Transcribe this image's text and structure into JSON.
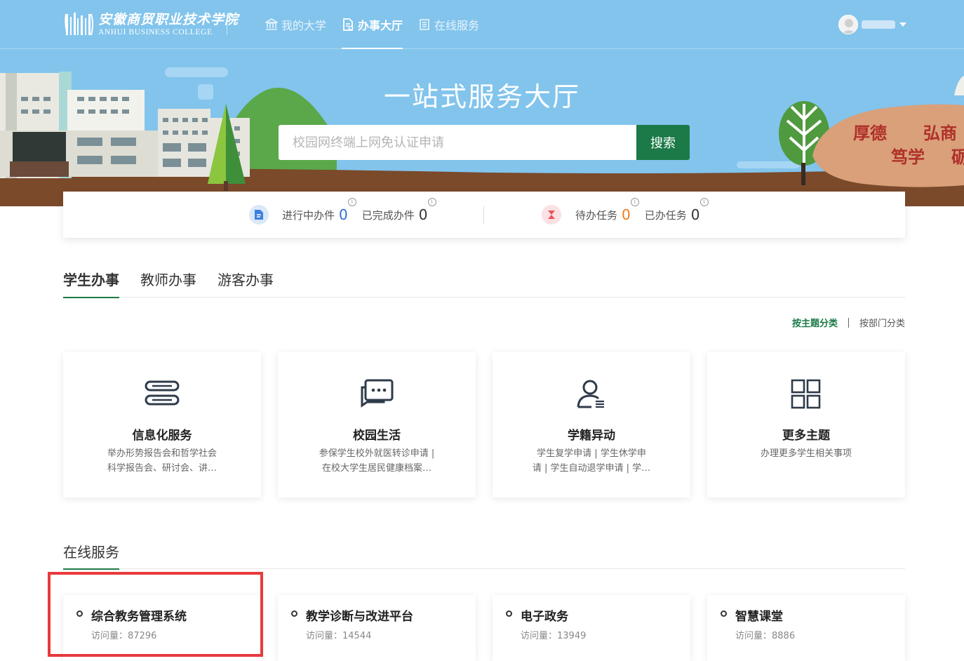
{
  "header": {
    "logo_cn": "安徽商贸职业技术学院",
    "logo_en": "ANHUI BUSINESS COLLEGE",
    "nav": [
      {
        "label": "我的大学",
        "icon": "building-icon",
        "active": false
      },
      {
        "label": "办事大厅",
        "icon": "document-icon",
        "active": true
      },
      {
        "label": "在线服务",
        "icon": "list-icon",
        "active": false
      }
    ]
  },
  "hero": {
    "title": "一站式服务大厅",
    "search_placeholder": "校园网终端上网免认证申请",
    "search_button": "搜索",
    "rock_text": [
      "厚德",
      "弘商",
      "笃学",
      "砺"
    ]
  },
  "stats": {
    "in_progress_label": "进行中办件",
    "in_progress_value": "0",
    "completed_label": "已完成办件",
    "completed_value": "0",
    "todo_label": "待办任务",
    "todo_value": "0",
    "done_label": "已办任务",
    "done_value": "0",
    "info_glyph": "i"
  },
  "tabs": [
    "学生办事",
    "教师办事",
    "游客办事"
  ],
  "sort": {
    "by_topic": "按主题分类",
    "by_department": "按部门分类"
  },
  "cards": [
    {
      "title": "信息化服务",
      "icon": "server-icon",
      "desc": [
        "举办形势报告会和哲学社会",
        "科学报告会、研讨会、讲…"
      ]
    },
    {
      "title": "校园生活",
      "icon": "chat-icon",
      "desc": [
        "参保学生校外就医转诊申请 |",
        "在校大学生居民健康档案…"
      ]
    },
    {
      "title": "学籍异动",
      "icon": "user-list-icon",
      "desc": [
        "学生复学申请 | 学生休学申",
        "请 | 学生自动退学申请 | 学…"
      ]
    },
    {
      "title": "更多主题",
      "icon": "grid-icon",
      "desc": [
        "办理更多学生相关事项"
      ]
    }
  ],
  "online_services": {
    "title": "在线服务",
    "items": [
      {
        "name": "综合教务管理系统",
        "visits_label": "访问量：87296"
      },
      {
        "name": "教学诊断与改进平台",
        "visits_label": "访问量：14544"
      },
      {
        "name": "电子政务",
        "visits_label": "访问量：13949"
      },
      {
        "name": "智慧课堂",
        "visits_label": "访问量：8886"
      }
    ]
  },
  "colors": {
    "primary_green": "#1b7a47",
    "banner_blue": "#82c4ec",
    "highlight_red": "#e8393c",
    "value_blue": "#2f6fd8",
    "value_orange": "#f07a1c"
  }
}
